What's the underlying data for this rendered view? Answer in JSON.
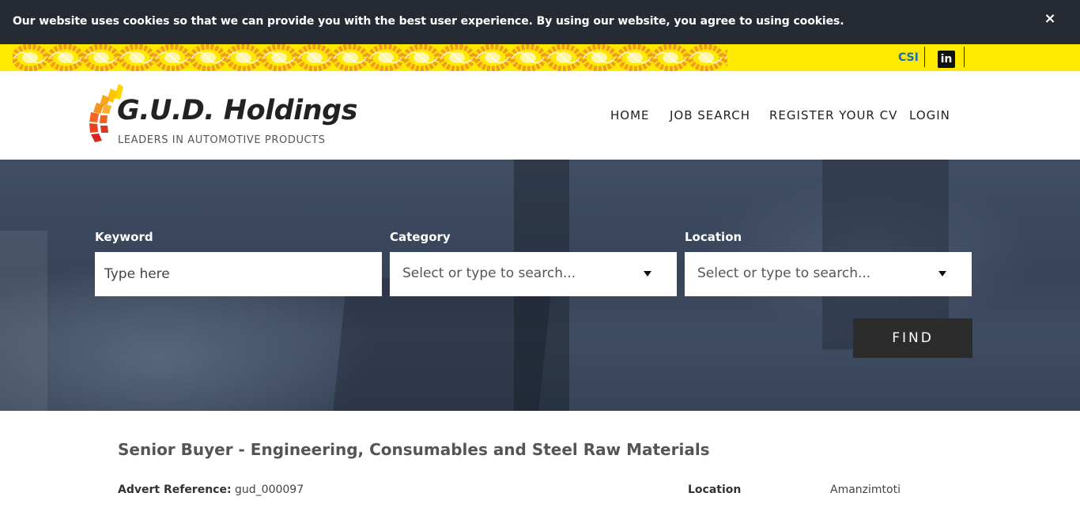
{
  "cookie": {
    "message": "Our website uses cookies so that we can provide you with the best user experience. By using our website, you agree to using cookies.",
    "close_label": "×"
  },
  "topbar": {
    "csi_label": "CSI",
    "linkedin_label": "in"
  },
  "brand": {
    "name": "G.U.D. Holdings",
    "tagline": "LEADERS IN AUTOMOTIVE PRODUCTS"
  },
  "nav": {
    "items": [
      {
        "label": "HOME"
      },
      {
        "label": "JOB SEARCH"
      },
      {
        "label": "REGISTER YOUR CV"
      },
      {
        "label": "LOGIN"
      }
    ]
  },
  "search": {
    "keyword_label": "Keyword",
    "keyword_placeholder": "Type here",
    "category_label": "Category",
    "category_value": "Select or type to search...",
    "location_label": "Location",
    "location_value": "Select or type to search...",
    "find_label": "FIND"
  },
  "job": {
    "title": "Senior Buyer - Engineering, Consumables and Steel Raw Materials",
    "advert_ref_label": "Advert Reference:",
    "advert_ref_value": "gud_000097",
    "location_label": "Location",
    "location_value": "Amanzimtoti"
  },
  "colors": {
    "cookie_bg": "#262a33",
    "strip_yellow": "#ffe900",
    "csi_blue": "#1a6bb7",
    "find_button": "#2c2c2c"
  }
}
